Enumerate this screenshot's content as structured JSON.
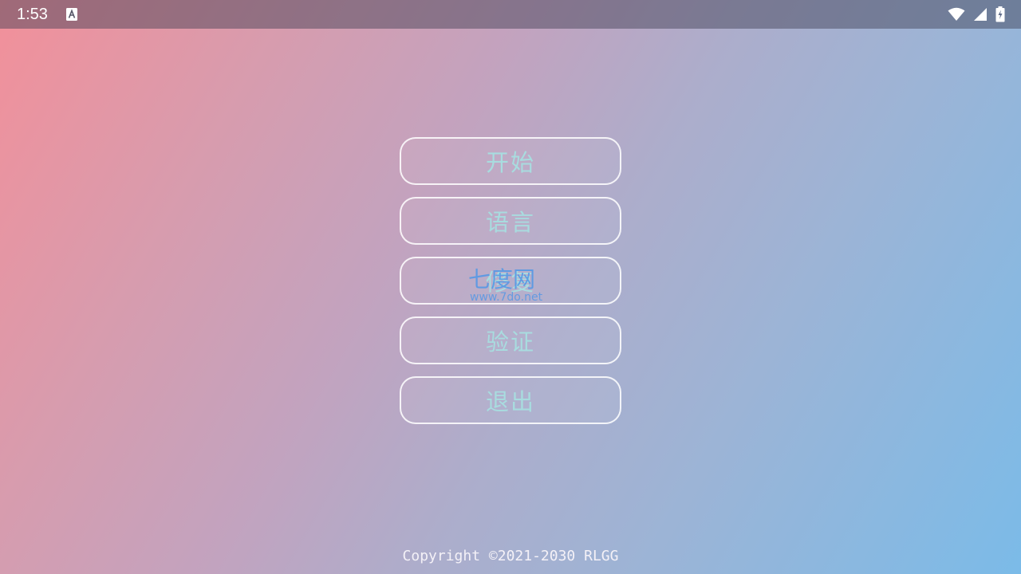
{
  "status_bar": {
    "time": "1:53",
    "left_icons": [
      "a-notification-icon"
    ],
    "right_icons": [
      "wifi-icon",
      "signal-icon",
      "battery-charging-icon"
    ]
  },
  "menu": {
    "items": [
      {
        "label": "开始"
      },
      {
        "label": "语言"
      },
      {
        "label": "修复"
      },
      {
        "label": "验证"
      },
      {
        "label": "退出"
      }
    ]
  },
  "watermark": {
    "title": "七度网",
    "url": "www.7do.net"
  },
  "footer": {
    "copyright": "Copyright ©2021-2030 RLGG"
  },
  "colors": {
    "button_text": "#a8dcdf",
    "button_border": "#ffffff",
    "gradient_start": "#f2909a",
    "gradient_end": "#7bbbe8"
  }
}
